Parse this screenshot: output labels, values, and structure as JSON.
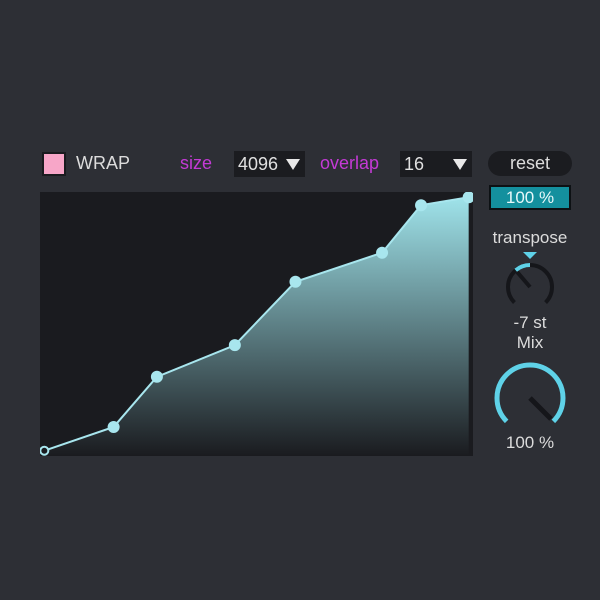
{
  "wrap": {
    "label": "WRAP",
    "checked": true
  },
  "size": {
    "label": "size",
    "value": "4096"
  },
  "overlap": {
    "label": "overlap",
    "value": "16"
  },
  "reset_label": "reset",
  "amount": "100 %",
  "transpose": {
    "label": "transpose",
    "value": "-7 st",
    "fraction": 0.35
  },
  "mix": {
    "label": "Mix",
    "value": "100 %",
    "fraction": 1.0
  },
  "colors": {
    "accent": "#5fd2e8",
    "magenta": "#c43ad6",
    "pink": "#f7a6c8"
  },
  "curve_points": [
    [
      0.01,
      0.02
    ],
    [
      0.17,
      0.11
    ],
    [
      0.27,
      0.3
    ],
    [
      0.45,
      0.42
    ],
    [
      0.59,
      0.66
    ],
    [
      0.79,
      0.77
    ],
    [
      0.88,
      0.95
    ],
    [
      0.99,
      0.98
    ]
  ]
}
